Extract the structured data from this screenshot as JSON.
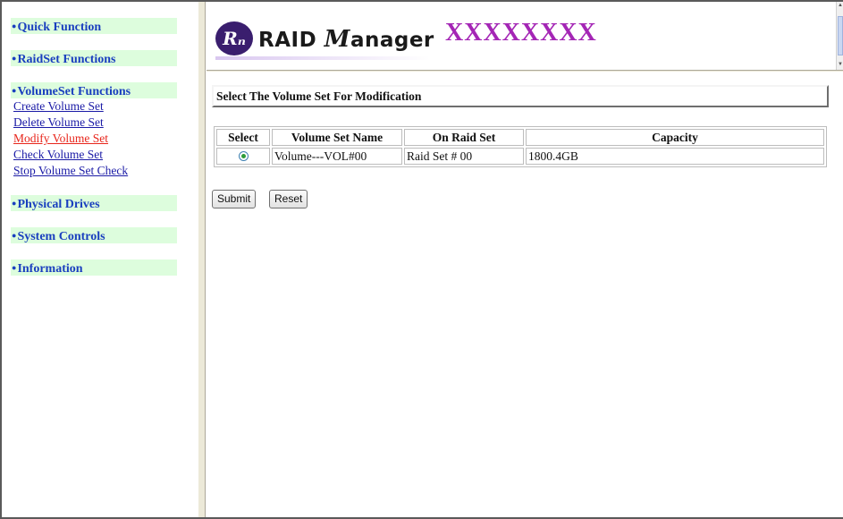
{
  "nav": {
    "sections": [
      {
        "label": "Quick Function",
        "items": []
      },
      {
        "label": "RaidSet Functions",
        "items": []
      },
      {
        "label": "VolumeSet Functions",
        "items": [
          {
            "label": "Create Volume Set",
            "active": false
          },
          {
            "label": "Delete Volume Set",
            "active": false
          },
          {
            "label": "Modify Volume Set",
            "active": true
          },
          {
            "label": "Check Volume Set",
            "active": false
          },
          {
            "label": "Stop Volume Set Check",
            "active": false
          }
        ]
      },
      {
        "label": "Physical Drives",
        "items": []
      },
      {
        "label": "System Controls",
        "items": []
      },
      {
        "label": "Information",
        "items": []
      }
    ]
  },
  "header": {
    "logo_badge": "Rₙ",
    "logo_word1": "RAID ",
    "logo_script": "M",
    "logo_word2": "anager",
    "product_name": "XXXXXXXX"
  },
  "main": {
    "title": "Select The Volume Set For Modification",
    "table": {
      "columns": [
        "Select",
        "Volume Set Name",
        "On Raid Set",
        "Capacity"
      ],
      "rows": [
        {
          "selected": true,
          "name": "Volume---VOL#00",
          "raid_set": "Raid Set # 00",
          "capacity": "1800.4GB"
        }
      ]
    },
    "submit_label": "Submit",
    "reset_label": "Reset"
  },
  "colors": {
    "nav_section_bg": "#ddfddd",
    "nav_section_text": "#1a3fbf",
    "nav_link": "#1a1aa6",
    "nav_link_active": "#e8261c",
    "product_name": "#a426b5",
    "logo_badge": "#3a1e6e"
  },
  "icons": {
    "section_bullet": "bullet-icon",
    "logo": "raid-manager-logo"
  }
}
